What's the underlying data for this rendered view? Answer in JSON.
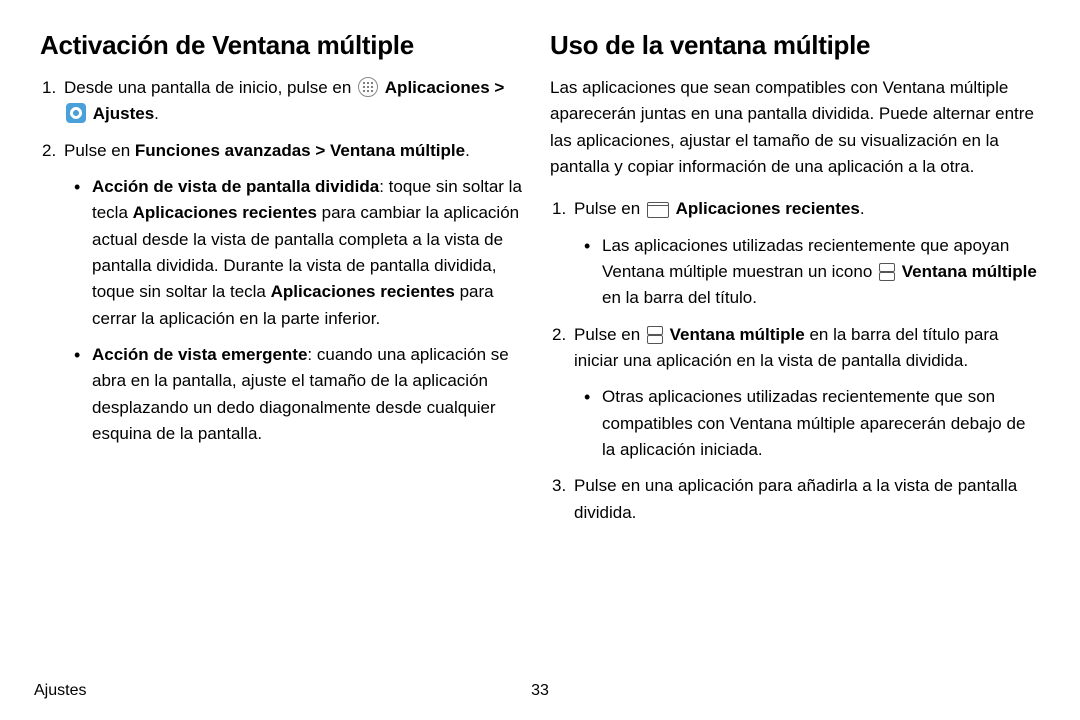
{
  "left": {
    "heading": "Activación de Ventana múltiple",
    "step1_pre": "Desde una pantalla de inicio, pulse en ",
    "apps_label": "Aplicaciones",
    "arrow": " > ",
    "settings_label": "Ajustes",
    "period": ".",
    "step2_pre": "Pulse en ",
    "step2_bold1": "Funciones avanzadas",
    "step2_bold2": "Ventana múltiple",
    "bullet1_bold": "Acción de vista de pantalla dividida",
    "bullet1_t1": ": toque sin soltar la tecla ",
    "bullet1_b2": "Aplicaciones recientes",
    "bullet1_t2": " para cambiar la aplicación actual desde la vista de pantalla completa a la vista de pantalla dividida. Durante la vista de pantalla dividida, toque sin soltar la tecla ",
    "bullet1_b3": "Aplicaciones recientes",
    "bullet1_t3": " para cerrar la aplicación en la parte inferior.",
    "bullet2_bold": "Acción de vista emergente",
    "bullet2_t1": ": cuando una aplicación se abra en la pantalla, ajuste el tamaño de la aplicación desplazando un dedo diagonalmente desde cualquier esquina de la pantalla."
  },
  "right": {
    "heading": "Uso de la ventana múltiple",
    "intro": "Las aplicaciones que sean compatibles con Ventana múltiple aparecerán juntas en una pantalla dividida. Puede alternar entre las aplicaciones, ajustar el tamaño de su visualización en la pantalla y copiar información de una aplicación a la otra.",
    "s1_pre": "Pulse en ",
    "s1_bold": "Aplicaciones recientes",
    "s1_b1_t1": "Las aplicaciones utilizadas recientemente que apoyan Ventana múltiple muestran un icono ",
    "s1_b1_bold": "Ventana múltiple",
    "s1_b1_t2": " en la barra del título.",
    "s2_pre": "Pulse en ",
    "s2_bold": "Ventana múltiple",
    "s2_post": " en la barra del título para iniciar una aplicación en la vista de pantalla dividida.",
    "s2_b1": "Otras aplicaciones utilizadas recientemente que son compatibles con Ventana múltiple aparecerán debajo de la aplicación iniciada.",
    "s3": "Pulse en una aplicación para añadirla a la vista de pantalla dividida."
  },
  "footer": {
    "section": "Ajustes",
    "page": "33"
  },
  "nums": {
    "n1": "1.",
    "n2": "2.",
    "n3": "3."
  }
}
